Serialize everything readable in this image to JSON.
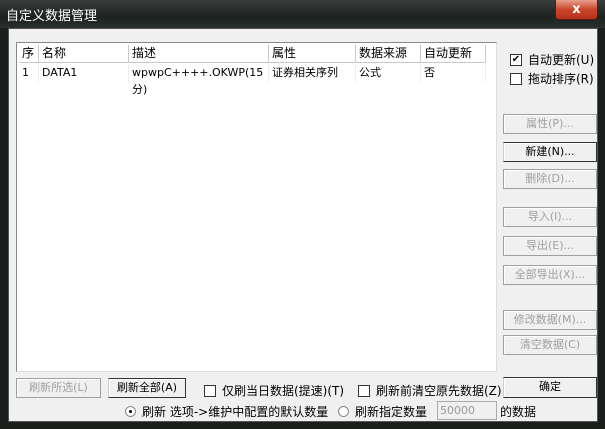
{
  "window": {
    "title": "自定义数据管理",
    "close": "x"
  },
  "list": {
    "headers": [
      "序",
      "名称",
      "描述",
      "属性",
      "数据来源",
      "自动更新"
    ],
    "rows": [
      [
        "1",
        "DATA1",
        "wpwpC++++.OKWP(15分)",
        "证券相关序列",
        "公式",
        "否"
      ]
    ]
  },
  "options": {
    "auto_update": {
      "label": "自动更新(U)",
      "checked": true
    },
    "drag_sort": {
      "label": "拖动排序(R)",
      "checked": false
    }
  },
  "buttons": {
    "properties": "属性(P)...",
    "new": "新建(N)...",
    "delete": "删除(D)...",
    "import": "导入(I)...",
    "export": "导出(E)...",
    "export_all": "全部导出(X)...",
    "modify": "修改数据(M)...",
    "clear": "清空数据(C)",
    "refresh_selected": "刷新所选(L)",
    "refresh_all": "刷新全部(A)",
    "ok": "确定"
  },
  "bottom": {
    "today_only": "仅刷当日数据(提速)(T)",
    "clear_before": "刷新前清空原先数据(Z)",
    "radio_default": "刷新 选项->维护中配置的默认数量",
    "radio_specified": "刷新指定数量",
    "count": "50000",
    "suffix": "的数据"
  }
}
